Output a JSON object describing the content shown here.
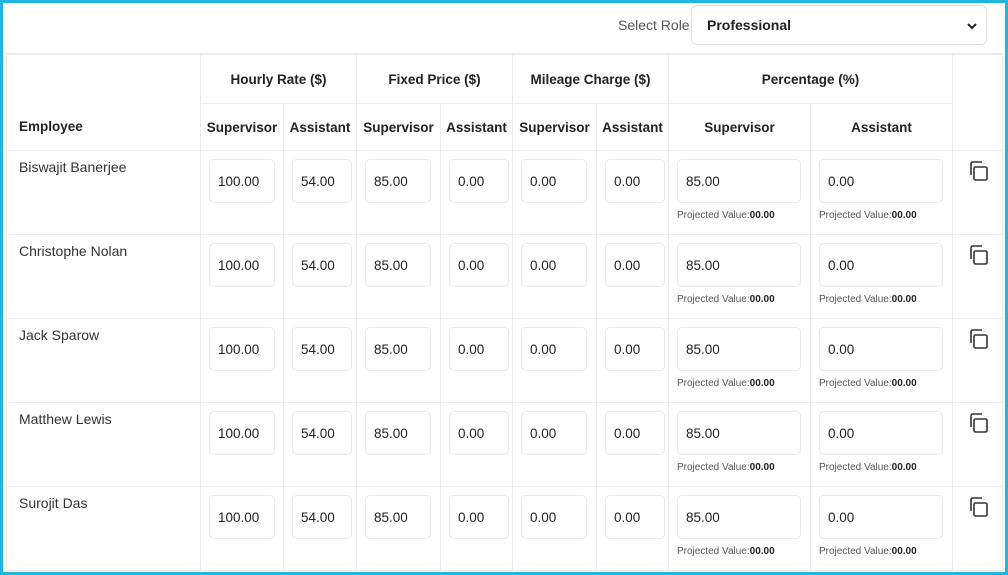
{
  "header": {
    "select_role_label": "Select Role",
    "select_role_value": "Professional"
  },
  "table": {
    "employee_header": "Employee",
    "groups": [
      "Hourly Rate ($)",
      "Fixed Price ($)",
      "Mileage Charge ($)",
      "Percentage (%)"
    ],
    "subheaders": [
      "Supervisor",
      "Assistant",
      "Supervisor",
      "Assistant",
      "Supervisor",
      "Assistant",
      "Supervisor",
      "Assistant"
    ],
    "projected_label": "Projected Value:",
    "rows": [
      {
        "name": "Biswajit Banerjee",
        "hourly_sup": "100.00",
        "hourly_asst": "54.00",
        "fixed_sup": "85.00",
        "fixed_asst": "0.00",
        "mileage_sup": "0.00",
        "mileage_asst": "0.00",
        "pct_sup": "85.00",
        "pct_asst": "0.00",
        "proj_sup": "00.00",
        "proj_asst": "00.00"
      },
      {
        "name": "Christophe Nolan",
        "hourly_sup": "100.00",
        "hourly_asst": "54.00",
        "fixed_sup": "85.00",
        "fixed_asst": "0.00",
        "mileage_sup": "0.00",
        "mileage_asst": "0.00",
        "pct_sup": "85.00",
        "pct_asst": "0.00",
        "proj_sup": "00.00",
        "proj_asst": "00.00"
      },
      {
        "name": "Jack Sparow",
        "hourly_sup": "100.00",
        "hourly_asst": "54.00",
        "fixed_sup": "85.00",
        "fixed_asst": "0.00",
        "mileage_sup": "0.00",
        "mileage_asst": "0.00",
        "pct_sup": "85.00",
        "pct_asst": "0.00",
        "proj_sup": "00.00",
        "proj_asst": "00.00"
      },
      {
        "name": "Matthew Lewis",
        "hourly_sup": "100.00",
        "hourly_asst": "54.00",
        "fixed_sup": "85.00",
        "fixed_asst": "0.00",
        "mileage_sup": "0.00",
        "mileage_asst": "0.00",
        "pct_sup": "85.00",
        "pct_asst": "0.00",
        "proj_sup": "00.00",
        "proj_asst": "00.00"
      },
      {
        "name": "Surojit Das",
        "hourly_sup": "100.00",
        "hourly_asst": "54.00",
        "fixed_sup": "85.00",
        "fixed_asst": "0.00",
        "mileage_sup": "0.00",
        "mileage_asst": "0.00",
        "pct_sup": "85.00",
        "pct_asst": "0.00",
        "proj_sup": "00.00",
        "proj_asst": "00.00"
      }
    ]
  },
  "icons": {
    "role_select": "chevron-down-icon",
    "row_action": "copy-icon"
  },
  "colors": {
    "frame_border": "#1fb6e0",
    "cell_border": "#e9ecef"
  }
}
